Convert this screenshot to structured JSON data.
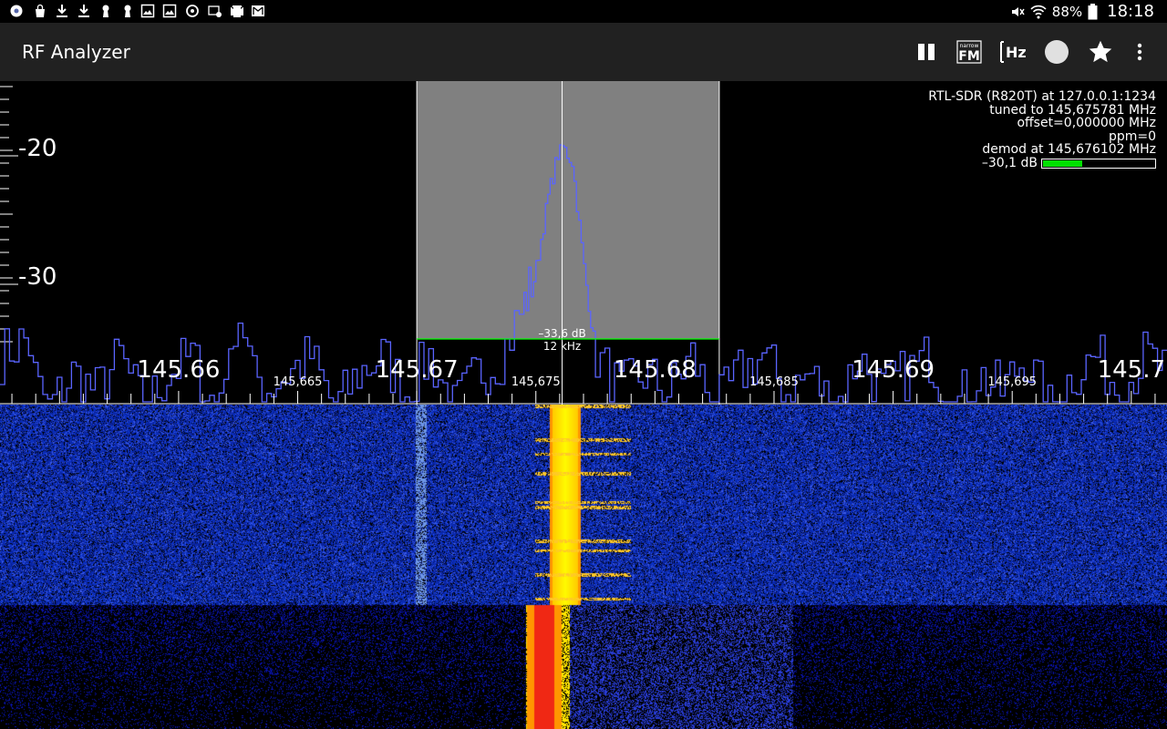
{
  "status_bar": {
    "left_icons": [
      "settings-gear-icon",
      "bag-icon",
      "download-icon",
      "download-icon",
      "keyhole-icon",
      "keyhole-icon",
      "image-icon",
      "image-icon",
      "sync-icon",
      "mail-settings-icon",
      "mail-icon",
      "trash-icon",
      "gmail-icon"
    ],
    "right_icons": [
      "mute-icon",
      "wifi-icon",
      "battery-icon"
    ],
    "battery": "88%",
    "time": "18:18"
  },
  "app_bar": {
    "title": "RF Analyzer",
    "actions": [
      "pause-icon",
      "narrow-fm-icon",
      "frequency-hz-icon",
      "record-circle-icon",
      "star-icon",
      "overflow-menu-icon"
    ],
    "nfm_top": "narrow",
    "nfm_bottom": "FM",
    "hz_label": "Hz"
  },
  "info": {
    "source": "RTL-SDR (R820T) at 127.0.0.1:1234",
    "tuned": "tuned to 145,675781 MHz",
    "offset": "offset=0,000000 MHz",
    "ppm": "ppm=0",
    "demod": "demod at 145,676102 MHz",
    "squelch_label": "–30,1 dB",
    "squelch_level": 0.35
  },
  "channel": {
    "squelch_label": "–33,6 dB",
    "bandwidth_label": "12 kHz"
  },
  "colors": {
    "trace": "#5a64ff",
    "selection": "#808080",
    "squelch_line": "#00ff00",
    "signal_bar": "#00e000"
  },
  "chart_data": {
    "type": "line",
    "xlabel": "",
    "ylabel": "",
    "x_range": [
      145.6525,
      145.7015
    ],
    "y_range": [
      -34.5,
      -16
    ],
    "major_ticks": [
      {
        "value": 145.66,
        "label": "145.66"
      },
      {
        "value": 145.67,
        "label": "145.67"
      },
      {
        "value": 145.68,
        "label": "145.68"
      },
      {
        "value": 145.69,
        "label": "145.69"
      },
      {
        "value": 145.7,
        "label": "145.7"
      }
    ],
    "minor_ticks": [
      {
        "value": 145.665,
        "label": "145,665"
      },
      {
        "value": 145.675,
        "label": "145,675"
      },
      {
        "value": 145.685,
        "label": "145,685"
      },
      {
        "value": 145.695,
        "label": "145,695"
      }
    ],
    "y_ticks": [
      {
        "value": -20,
        "label": "-20"
      },
      {
        "value": -30,
        "label": "-30"
      }
    ],
    "channel_low": 145.67,
    "channel_high": 145.6827,
    "demod_freq": 145.676102,
    "squelch_db": -33.6,
    "series": [
      {
        "x": [
          145.6525,
          145.6535,
          145.6545,
          145.6555,
          145.6565,
          145.6575,
          145.6585,
          145.6595,
          145.6605,
          145.6615,
          145.6625,
          145.6635,
          145.6645,
          145.6655,
          145.6665,
          145.6675,
          145.6685,
          145.6695,
          145.6705,
          145.6715,
          145.6725,
          145.6735,
          145.6745,
          145.675,
          145.6755,
          145.676,
          145.6765,
          145.677,
          145.6775,
          145.6785,
          145.6795,
          145.6805,
          145.6815,
          145.6825,
          145.6835,
          145.6845,
          145.6855,
          145.6865,
          145.6875,
          145.6885,
          145.6895,
          145.6905,
          145.6915,
          145.6925,
          145.6935,
          145.6945,
          145.6955,
          145.6965,
          145.6975,
          145.6985,
          145.6995,
          145.7005,
          145.7015
        ],
        "y": [
          -31,
          -30,
          -34,
          -32,
          -33,
          -31,
          -34,
          -32,
          -31,
          -34,
          -29,
          -33,
          -32,
          -31,
          -34,
          -32,
          -31,
          -33,
          -31,
          -34,
          -32,
          -31,
          -28,
          -26,
          -22,
          -19,
          -20,
          -26,
          -31,
          -33,
          -32,
          -33,
          -31,
          -34,
          -32,
          -31,
          -33,
          -32,
          -34,
          -31,
          -33,
          -32,
          -31,
          -34,
          -32,
          -33,
          -31,
          -34,
          -32,
          -31,
          -33,
          -31,
          -32
        ]
      }
    ]
  }
}
